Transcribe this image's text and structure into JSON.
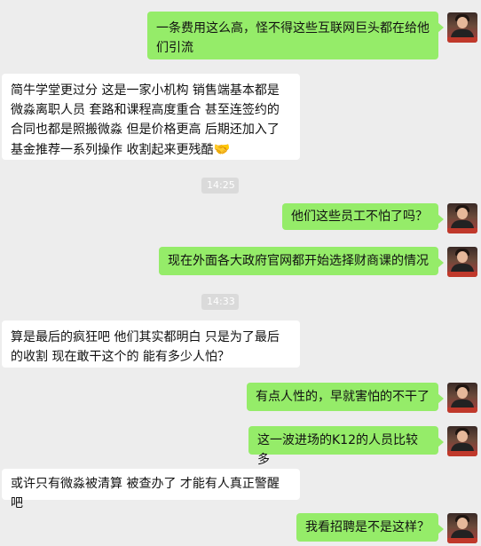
{
  "messages": [
    {
      "side": "me",
      "text": "一条费用这么高，怪不得这些互联网巨头都在给他们引流"
    },
    {
      "side": "other",
      "text": "简牛学堂更过分 这是一家小机构 销售端基本都是微淼离职人员 套路和课程高度重合 甚至连签约的合同也都是照搬微淼 但是价格更高 后期还加入了基金推荐一系列操作 收割起来更残酷",
      "emoji": "🤝",
      "emoji_name": "handshake-emoji"
    },
    {
      "type": "time",
      "text": "14:25"
    },
    {
      "side": "me",
      "text": "他们这些员工不怕了吗？"
    },
    {
      "side": "me",
      "text": "现在外面各大政府官网都开始选择财商课的情况"
    },
    {
      "type": "time",
      "text": "14:33"
    },
    {
      "side": "other",
      "text": "算是最后的疯狂吧 他们其实都明白 只是为了最后的收割 现在敢干这个的 能有多少人怕？"
    },
    {
      "side": "me",
      "text": "有点人性的，早就害怕的不干了"
    },
    {
      "side": "me",
      "text": "这一波进场的K12的人员比较多"
    },
    {
      "side": "other",
      "text": "或许只有微淼被清算 被查办了 才能有人真正警醒吧"
    },
    {
      "side": "me",
      "text": "我看招聘是不是这样？"
    }
  ],
  "colors": {
    "background": "#ededed",
    "me_bubble": "#95ec69",
    "other_bubble": "#ffffff",
    "time_badge": "#dadada"
  }
}
